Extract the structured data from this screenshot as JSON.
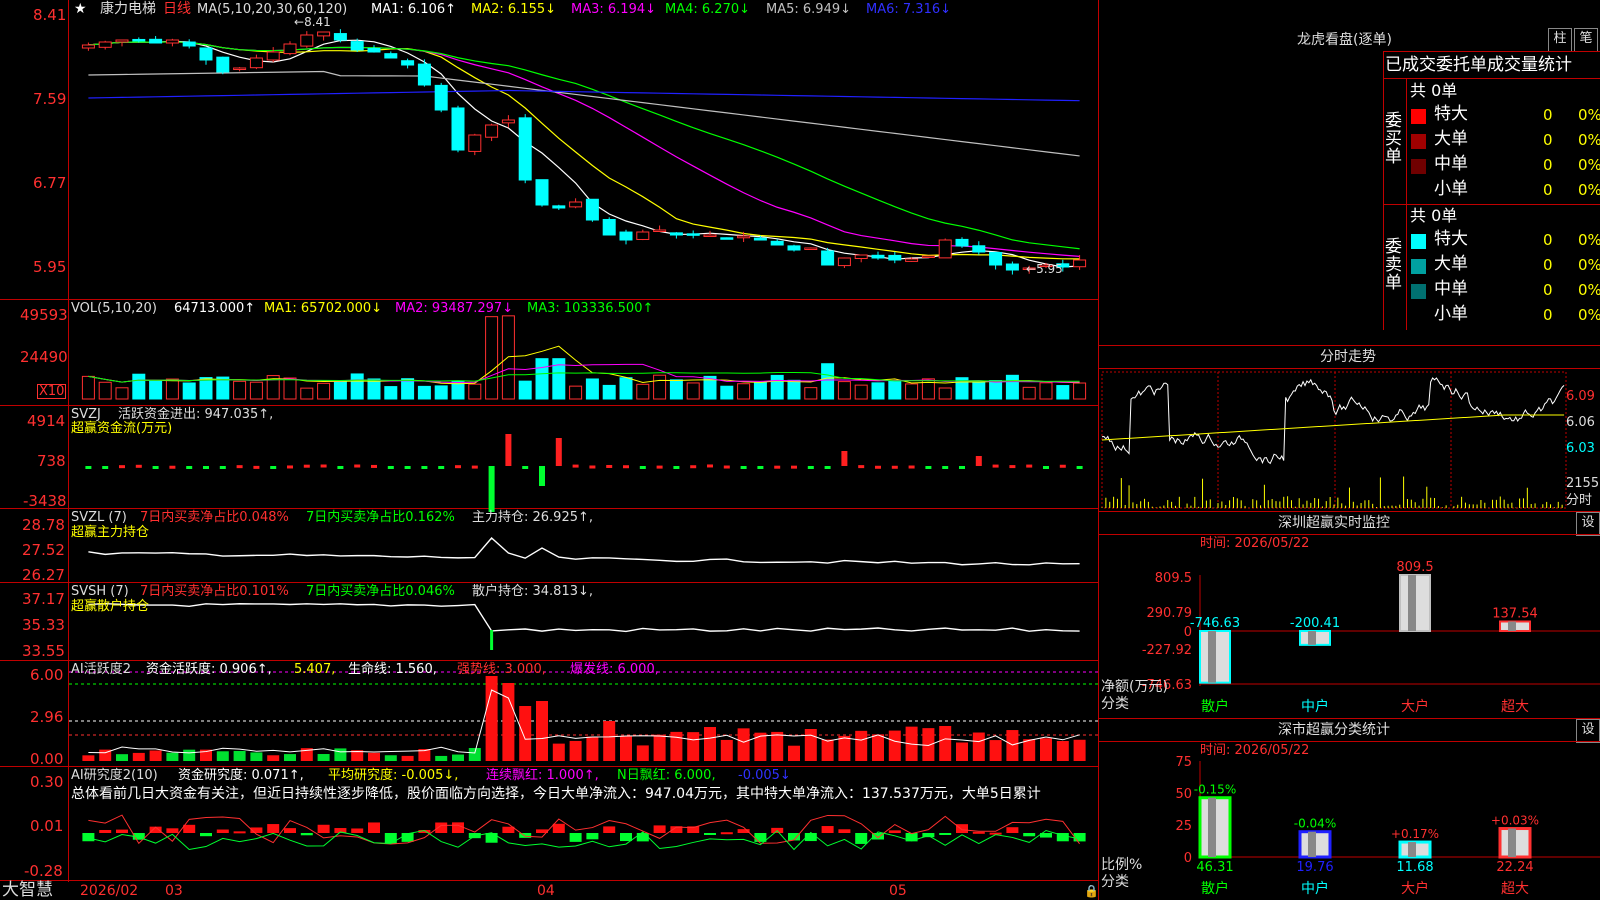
{
  "stock": {
    "name": "康力电梯",
    "period": "日线"
  },
  "main_chart": {
    "ma_label": "MA(5,10,20,30,60,120)",
    "ma_values": [
      {
        "text": "MA1: 6.106↑",
        "color": "#ffffff"
      },
      {
        "text": "MA2: 6.155↓",
        "color": "#ffff00"
      },
      {
        "text": "MA3: 6.194↓",
        "color": "#ff00ff"
      },
      {
        "text": "MA4: 6.270↓",
        "color": "#00ff00"
      },
      {
        "text": "MA5: 6.949↓",
        "color": "#c0c0c0"
      },
      {
        "text": "MA6: 7.316↓",
        "color": "#3030ff"
      }
    ],
    "y_ticks": [
      "8.41",
      "7.59",
      "6.77",
      "5.95"
    ],
    "high_marker": "8.41",
    "low_marker": "5.95",
    "star": "★"
  },
  "vol": {
    "label": "VOL(5,10,20)",
    "value": "64713.000↑",
    "ma1": "MA1: 65702.000↓",
    "ma2": "MA2: 93487.297↓",
    "ma3": "MA3: 103336.500↑",
    "y_ticks": [
      "49593",
      "24490"
    ],
    "unit": "X10"
  },
  "svzj": {
    "label": "SVZJ",
    "text": "活跃资金进出: 947.035↑,",
    "subtitle": "超赢资金流(万元)",
    "y_ticks": [
      "4914",
      "738",
      "-3438"
    ]
  },
  "svzl": {
    "label": "SVZL (7)",
    "t1": "7日内买卖净占比0.048%",
    "t2": "7日内买卖净占比0.162%",
    "t3": "主力持仓: 26.925↑,",
    "subtitle": "超赢主力持仓",
    "y_ticks": [
      "28.78",
      "27.52",
      "26.27"
    ]
  },
  "svsh": {
    "label": "SVSH (7)",
    "t1": "7日内买卖净占比0.101%",
    "t2": "7日内买卖净占比0.046%",
    "t3": "散户持仓: 34.813↓,",
    "subtitle": "超赢散户持仓",
    "y_ticks": [
      "37.17",
      "35.33",
      "33.55"
    ]
  },
  "ai1": {
    "label": "AI活跃度2",
    "t1": "资金活跃度: 0.906↑,",
    "t2": "5.407,",
    "t3": "生命线: 1.560,",
    "t4": "强势线: 3.000,",
    "t5": "爆发线: 6.000,",
    "y_ticks": [
      "6.00",
      "2.96",
      "0.00"
    ]
  },
  "ai2": {
    "label": "AI研究度2(10)",
    "t1": "资金研究度: 0.071↑,",
    "t2": "平均研究度: -0.005↓,",
    "t3": "连续飘红: 1.000↑,",
    "t4": "N日飘红: 6.000,",
    "t5": "-0.005↓",
    "summary": "总体看前几日大资金有关注，但近日持续性逐步降低，股价面临方向选择，今日大单净流入：947.04万元，其中特大单净流入：137.537万元，大单5日累计",
    "y_ticks": [
      "0.30",
      "0.01",
      "-0.28"
    ]
  },
  "xaxis": {
    "logo": "大智慧",
    "labels": [
      "2026/02",
      "03",
      "04",
      "05"
    ]
  },
  "longhu": {
    "title": "龙虎看盘(逐单)",
    "btn1": "柱",
    "btn2": "笔",
    "header": "已成交委托单成交量统计",
    "buy_label": "委买单",
    "sell_label": "委卖单",
    "buy_total": "共 0单",
    "sell_total": "共 0单",
    "buy_rows": [
      {
        "name": "特大",
        "val": "0",
        "pct": "0%",
        "color": "#ff0000"
      },
      {
        "name": "大单",
        "val": "0",
        "pct": "0%",
        "color": "#a00000"
      },
      {
        "name": "中单",
        "val": "0",
        "pct": "0%",
        "color": "#700000"
      },
      {
        "name": "小单",
        "val": "0",
        "pct": "0%",
        "color": "#000000"
      }
    ],
    "sell_rows": [
      {
        "name": "特大",
        "val": "0",
        "pct": "0%",
        "color": "#00ffff"
      },
      {
        "name": "大单",
        "val": "0",
        "pct": "0%",
        "color": "#00a0a0"
      },
      {
        "name": "中单",
        "val": "0",
        "pct": "0%",
        "color": "#007070"
      },
      {
        "name": "小单",
        "val": "0",
        "pct": "0%",
        "color": "#000000"
      }
    ]
  },
  "minute": {
    "title": "分时走势",
    "y_ticks": [
      "6.09",
      "6.06",
      "6.03"
    ],
    "vol_tick": "2155",
    "vol_unit": "分时"
  },
  "monitor": {
    "title": "深圳超赢实时监控",
    "settings": "设",
    "time": "时间: 2026/05/22",
    "y_ticks": [
      "809.5",
      "290.79",
      "0",
      "-227.92",
      "-746.63"
    ],
    "side_label1": "净额(万元)",
    "side_label2": "分类",
    "categories": [
      "散户",
      "中户",
      "大户",
      "超大"
    ],
    "values": [
      -746.63,
      -200.41,
      809.5,
      137.54
    ],
    "value_labels": [
      "-746.63",
      "-200.41",
      "809.5",
      "137.54"
    ]
  },
  "classify": {
    "title": "深市超赢分类统计",
    "settings": "设",
    "time": "时间: 2026/05/22",
    "y_ticks": [
      "75",
      "50",
      "25",
      "0"
    ],
    "side_label1": "比例%",
    "side_label2": "分类",
    "categories": [
      "散户",
      "中户",
      "大户",
      "超大"
    ],
    "values": [
      46.31,
      19.76,
      11.68,
      22.24
    ],
    "changes": [
      "-0.15%",
      "-0.04%",
      "+0.17%",
      "+0.03%"
    ],
    "value_labels": [
      "46.31",
      "19.76",
      "11.68",
      "22.24"
    ]
  }
}
